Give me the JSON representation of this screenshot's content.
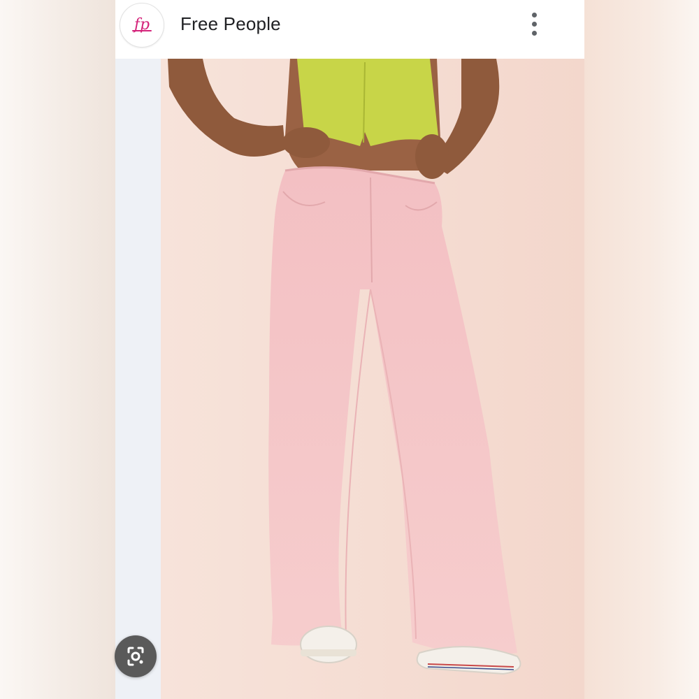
{
  "header": {
    "brand_logo_text": "fp",
    "brand_name": "Free People"
  },
  "icons": {
    "more": "more-vert-icon",
    "lens": "google-lens-icon"
  },
  "colors": {
    "brand_pink": "#d4237a",
    "jeans_pink": "#f6c4c4",
    "top_green": "#c8d548"
  }
}
